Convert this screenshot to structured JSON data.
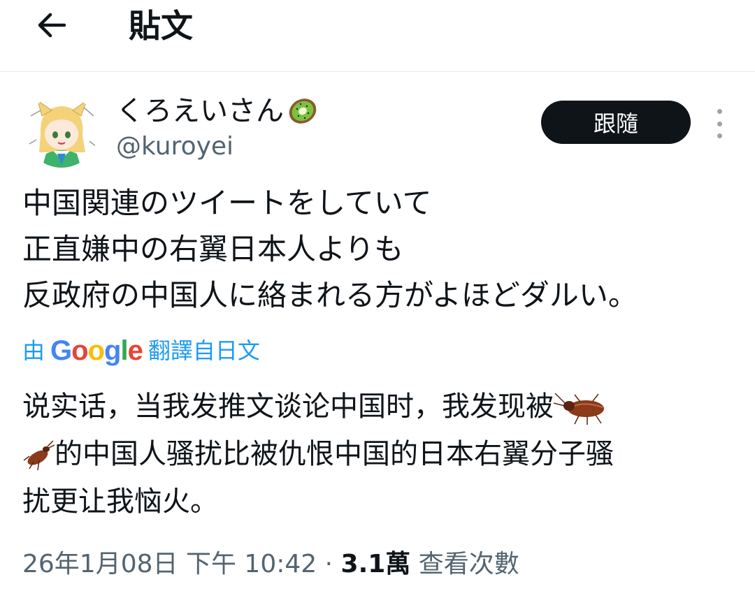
{
  "header": {
    "title": "貼文"
  },
  "author": {
    "display_name": "くろえいさん",
    "name_emoji": "kiwi-emoji",
    "handle": "@kuroyei",
    "follow_label": "跟隨"
  },
  "tweet": {
    "lines": [
      "中国関連のツイートをしていて",
      "正直嫌中の右翼日本人よりも",
      "反政府の中国人に絡まれる方がよほどダルい。"
    ]
  },
  "translation": {
    "prefix": "由",
    "provider": "Google",
    "suffix": "翻譯自日文",
    "line1": "说实话，当我发推文谈论中国时，我发现被",
    "line1_tail": "",
    "line2": "的中国人骚扰比被仇恨中国的日本右翼分子骚",
    "line3": "扰更让我恼火。"
  },
  "meta": {
    "timestamp": "26年1月08日 下午 10:42",
    "separator": "·",
    "views_count": "3.1萬",
    "views_label": "查看次數"
  },
  "icons": [
    "back-arrow-icon",
    "more-vertical-icon",
    "kiwi-emoji",
    "cockroach-emoji",
    "avatar-image"
  ]
}
